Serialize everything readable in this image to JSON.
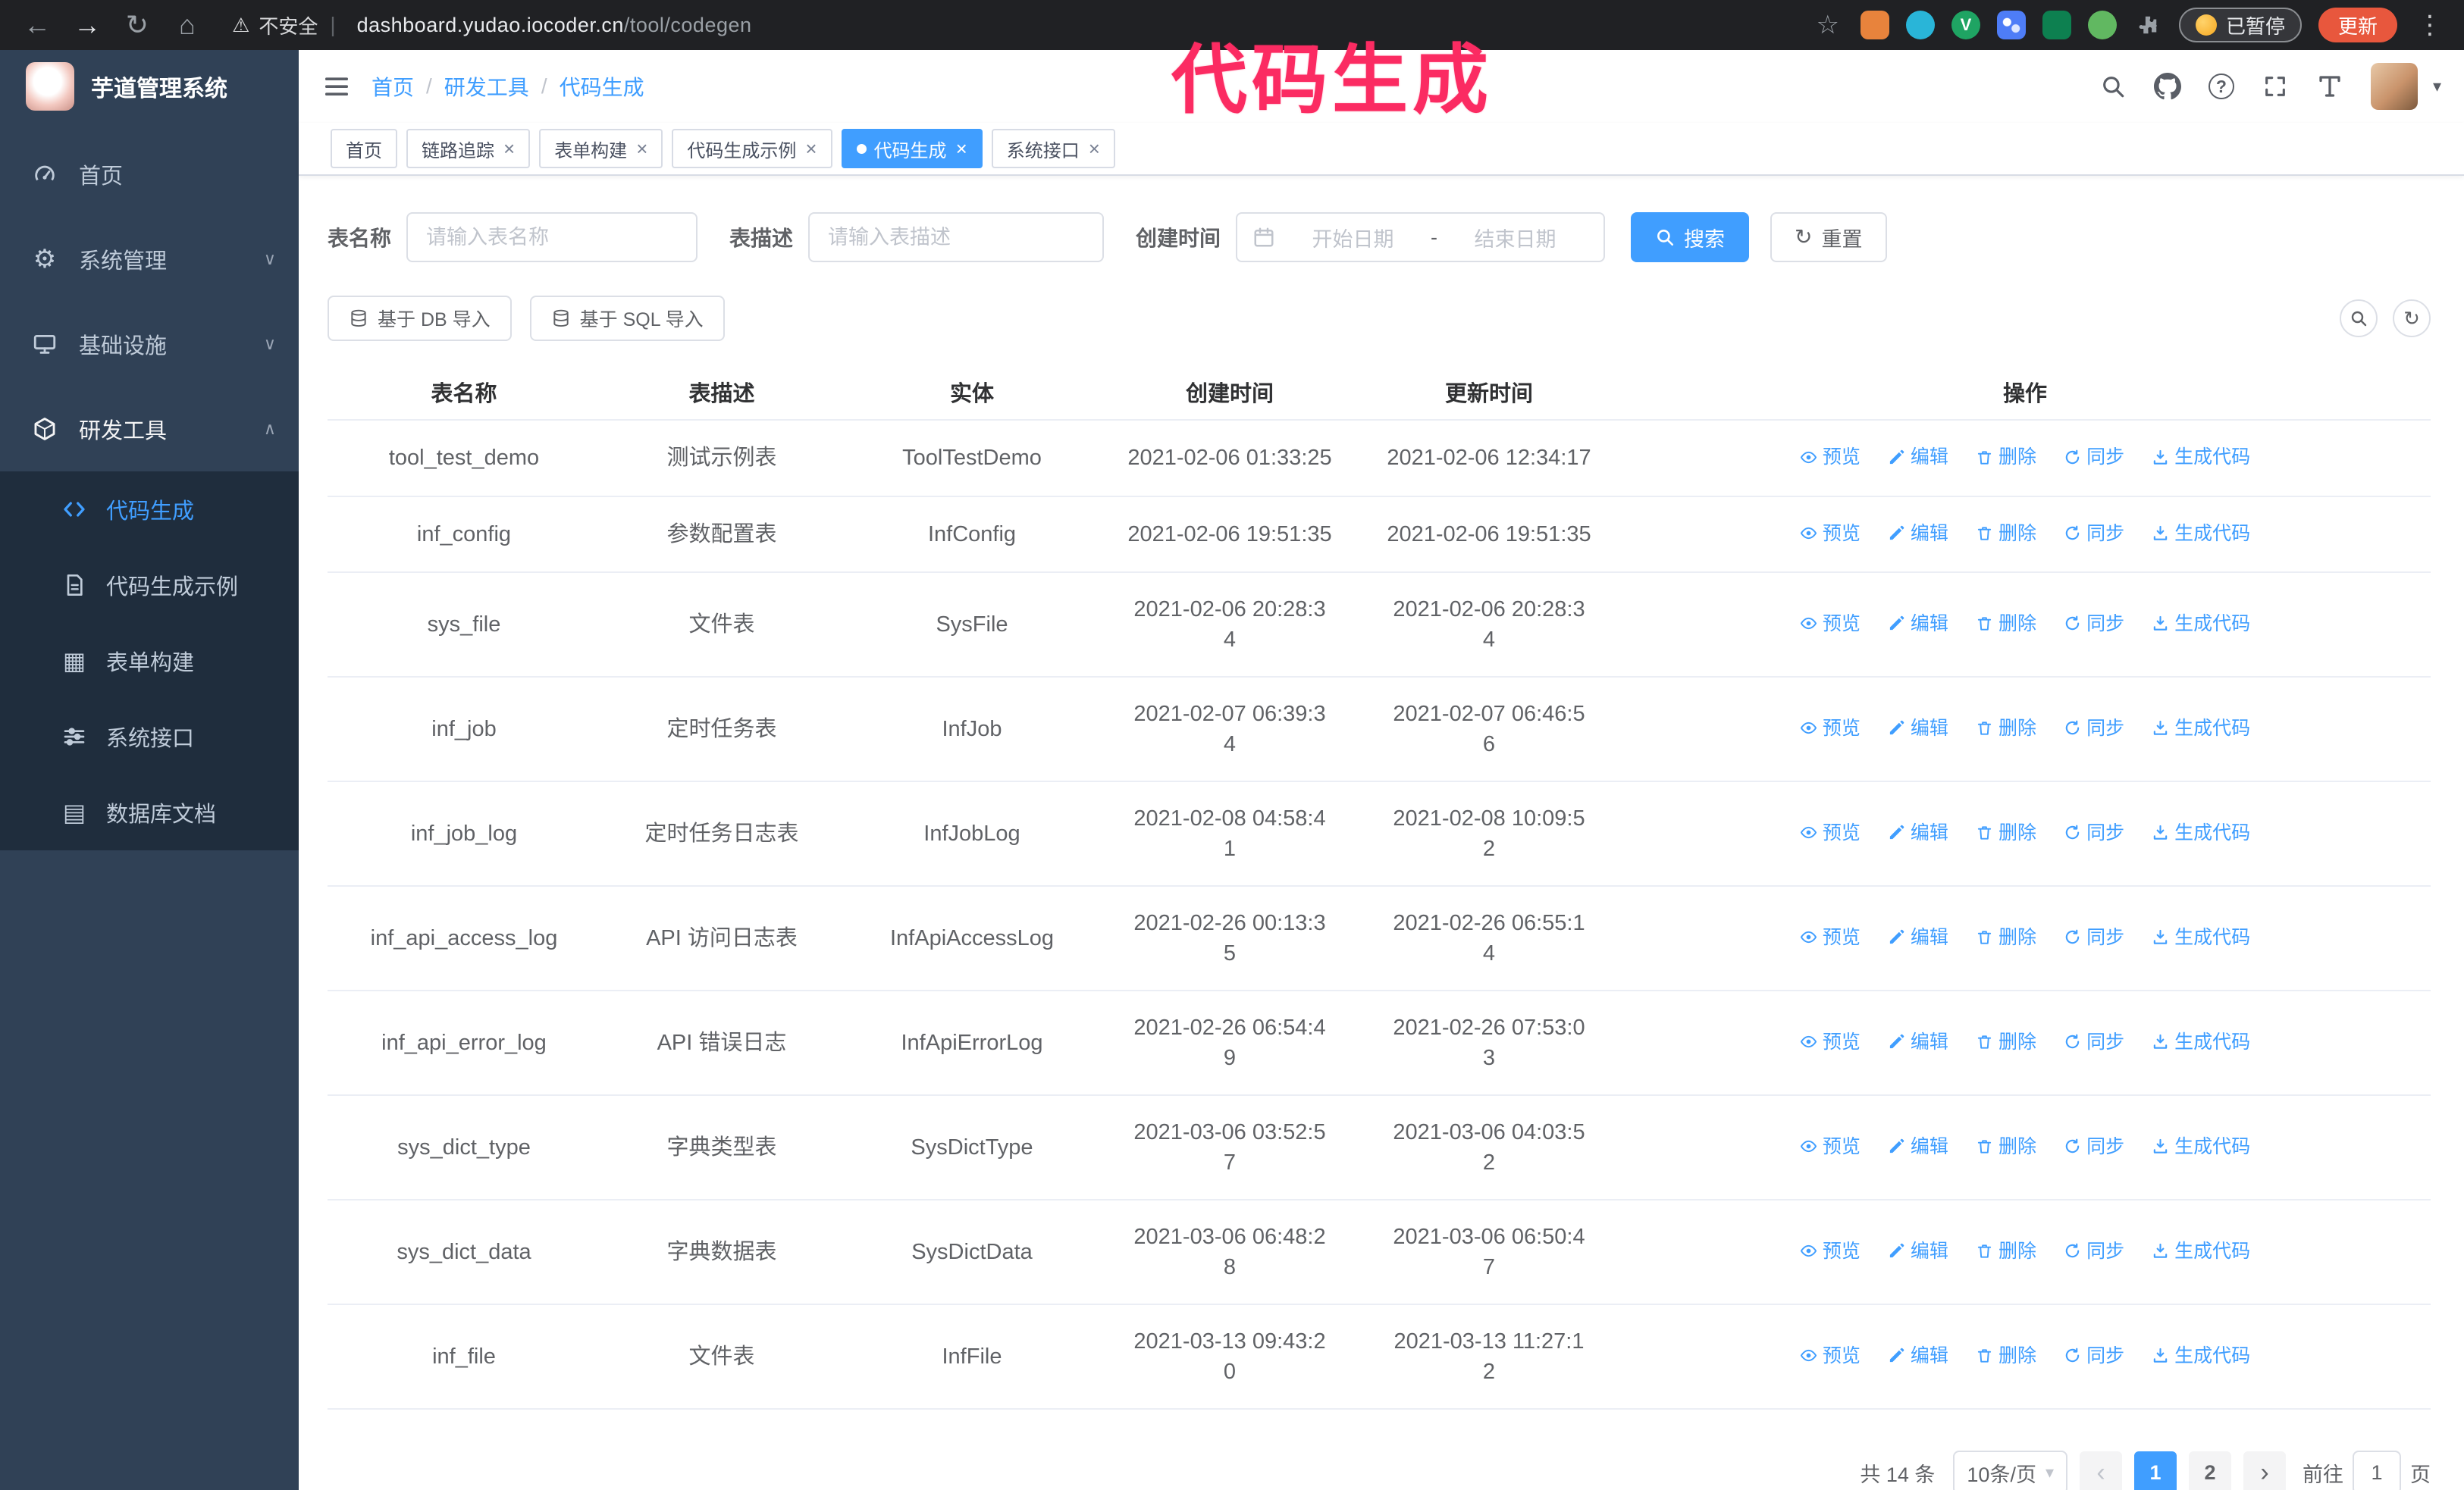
{
  "accent_color": "#409EFF",
  "annotation": {
    "text": "代码生成",
    "color": "#fb2b62"
  },
  "browser": {
    "security_label": "不安全",
    "url_domain": "dashboard.yudao.iocoder.cn",
    "url_path": "/tool/codegen",
    "paused_badge": "已暂停",
    "update_button": "更新"
  },
  "icons": {
    "back": "←",
    "forward": "→",
    "reload": "↻",
    "home": "⌂",
    "warning": "⚠",
    "star": "☆",
    "more": "⋮",
    "divider": "|",
    "close": "×",
    "caret_down": "▾",
    "chevron_down": "∨",
    "chevron_up": "∧",
    "gear": "⚙",
    "grid": "▦",
    "sheet": "▤",
    "refresh": "↻",
    "question": "?",
    "ext_v": "V",
    "prev": "‹",
    "next": "›"
  },
  "header": {
    "logo_title": "芋道管理系统",
    "breadcrumb": {
      "items": [
        "首页",
        "研发工具",
        "代码生成"
      ],
      "separator": "/"
    }
  },
  "sidebar": {
    "items": [
      {
        "label": "首页"
      },
      {
        "label": "系统管理"
      },
      {
        "label": "基础设施"
      },
      {
        "label": "研发工具",
        "open": true
      }
    ],
    "submenu": [
      {
        "label": "代码生成",
        "active": true
      },
      {
        "label": "代码生成示例"
      },
      {
        "label": "表单构建"
      },
      {
        "label": "系统接口"
      },
      {
        "label": "数据库文档"
      }
    ]
  },
  "tabs": [
    {
      "label": "首页",
      "closable": false
    },
    {
      "label": "链路追踪",
      "closable": true
    },
    {
      "label": "表单构建",
      "closable": true
    },
    {
      "label": "代码生成示例",
      "closable": true
    },
    {
      "label": "代码生成",
      "closable": true,
      "active": true
    },
    {
      "label": "系统接口",
      "closable": true
    }
  ],
  "filters": {
    "name_label": "表名称",
    "name_placeholder": "请输入表名称",
    "desc_label": "表描述",
    "desc_placeholder": "请输入表描述",
    "time_label": "创建时间",
    "start_placeholder": "开始日期",
    "range_separator": "-",
    "end_placeholder": "结束日期",
    "search_label": "搜索",
    "reset_label": "重置"
  },
  "toolbar": {
    "import_db_label": "基于 DB 导入",
    "import_sql_label": "基于 SQL 导入"
  },
  "table": {
    "columns": [
      "表名称",
      "表描述",
      "实体",
      "创建时间",
      "更新时间",
      "操作"
    ],
    "actions": [
      "预览",
      "编辑",
      "删除",
      "同步",
      "生成代码"
    ],
    "rows": [
      {
        "name": "tool_test_demo",
        "desc": "测试示例表",
        "entity": "ToolTestDemo",
        "created": "2021-02-06 01:33:25",
        "updated": "2021-02-06 12:34:17"
      },
      {
        "name": "inf_config",
        "desc": "参数配置表",
        "entity": "InfConfig",
        "created": "2021-02-06 19:51:35",
        "updated": "2021-02-06 19:51:35"
      },
      {
        "name": "sys_file",
        "desc": "文件表",
        "entity": "SysFile",
        "created": "2021-02-06 20:28:34",
        "updated": "2021-02-06 20:28:34"
      },
      {
        "name": "inf_job",
        "desc": "定时任务表",
        "entity": "InfJob",
        "created": "2021-02-07 06:39:34",
        "updated": "2021-02-07 06:46:56"
      },
      {
        "name": "inf_job_log",
        "desc": "定时任务日志表",
        "entity": "InfJobLog",
        "created": "2021-02-08 04:58:41",
        "updated": "2021-02-08 10:09:52"
      },
      {
        "name": "inf_api_access_log",
        "desc": "API 访问日志表",
        "entity": "InfApiAccessLog",
        "created": "2021-02-26 00:13:35",
        "updated": "2021-02-26 06:55:14"
      },
      {
        "name": "inf_api_error_log",
        "desc": "API 错误日志",
        "entity": "InfApiErrorLog",
        "created": "2021-02-26 06:54:49",
        "updated": "2021-02-26 07:53:03"
      },
      {
        "name": "sys_dict_type",
        "desc": "字典类型表",
        "entity": "SysDictType",
        "created": "2021-03-06 03:52:57",
        "updated": "2021-03-06 04:03:52"
      },
      {
        "name": "sys_dict_data",
        "desc": "字典数据表",
        "entity": "SysDictData",
        "created": "2021-03-06 06:48:28",
        "updated": "2021-03-06 06:50:47"
      },
      {
        "name": "inf_file",
        "desc": "文件表",
        "entity": "InfFile",
        "created": "2021-03-13 09:43:20",
        "updated": "2021-03-13 11:27:12"
      }
    ]
  },
  "pagination": {
    "total": "共 14 条",
    "page_size": "10条/页",
    "pages": [
      "1",
      "2"
    ],
    "current_page": "1",
    "goto_label": "前往",
    "goto_value": "1",
    "goto_suffix": "页"
  }
}
